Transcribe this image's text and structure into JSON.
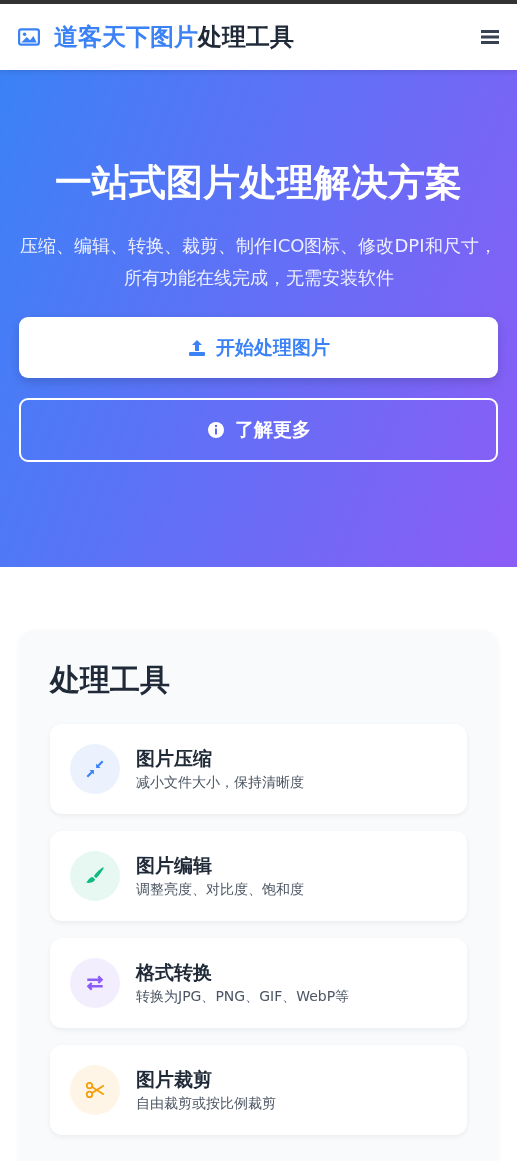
{
  "header": {
    "brand_highlight": "道客天下图片",
    "brand_rest": "处理工具"
  },
  "hero": {
    "title": "一站式图片处理解决方案",
    "subtitle": "压缩、编辑、转换、裁剪、制作ICO图标、修改DPI和尺寸，所有功能在线完成，无需安装软件",
    "buttons": [
      {
        "kind": "primary",
        "label": "开始处理图片"
      },
      {
        "kind": "outline",
        "label": "了解更多"
      }
    ]
  },
  "tools": {
    "title": "处理工具",
    "items": [
      {
        "kind": "compress",
        "color": "#3b82f6",
        "name": "图片压缩",
        "description": "减小文件大小，保持清晰度"
      },
      {
        "kind": "brush",
        "color": "#10b981",
        "name": "图片编辑",
        "description": "调整亮度、对比度、饱和度"
      },
      {
        "kind": "swap",
        "color": "#8b5cf6",
        "name": "格式转换",
        "description": "转换为JPG、PNG、GIF、WebP等"
      },
      {
        "kind": "scissors",
        "color": "#f59e0b",
        "name": "图片裁剪",
        "description": "自由裁剪或按比例裁剪"
      }
    ]
  }
}
